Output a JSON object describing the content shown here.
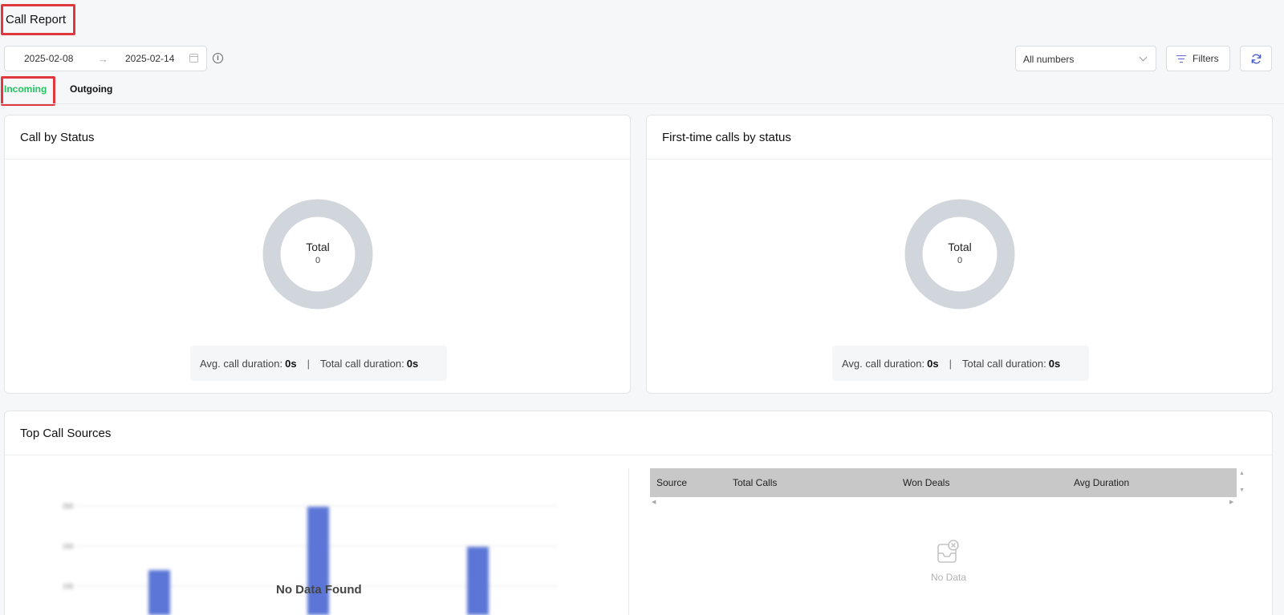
{
  "header": {
    "title": "Call Report",
    "date_start": "2025-02-08",
    "date_end": "2025-02-14",
    "numbers_select": "All numbers",
    "filters_label": "Filters"
  },
  "tabs": [
    {
      "label": "Incoming",
      "active": true
    },
    {
      "label": "Outgoing",
      "active": false
    }
  ],
  "cards": {
    "call_by_status": {
      "title": "Call by Status",
      "total_label": "Total",
      "total_value": "0",
      "avg_label": "Avg. call duration:",
      "avg_value": "0s",
      "separator": "|",
      "total_duration_label": "Total call duration:",
      "total_duration_value": "0s"
    },
    "first_time_calls": {
      "title": "First-time calls by status",
      "total_label": "Total",
      "total_value": "0",
      "avg_label": "Avg. call duration:",
      "avg_value": "0s",
      "separator": "|",
      "total_duration_label": "Total call duration:",
      "total_duration_value": "0s"
    },
    "top_call_sources": {
      "title": "Top Call Sources",
      "chart_empty_text": "No Data Found",
      "table_columns": [
        "Source",
        "Total Calls",
        "Won Deals",
        "Avg Duration"
      ],
      "table_empty_text": "No Data"
    }
  },
  "colors": {
    "active_tab": "#22c55e",
    "highlight_border": "#e0383e",
    "donut_ring": "#d1d5dc",
    "placeholder_bars": "#5b76d6",
    "table_header_bg": "#c8c8c8"
  }
}
